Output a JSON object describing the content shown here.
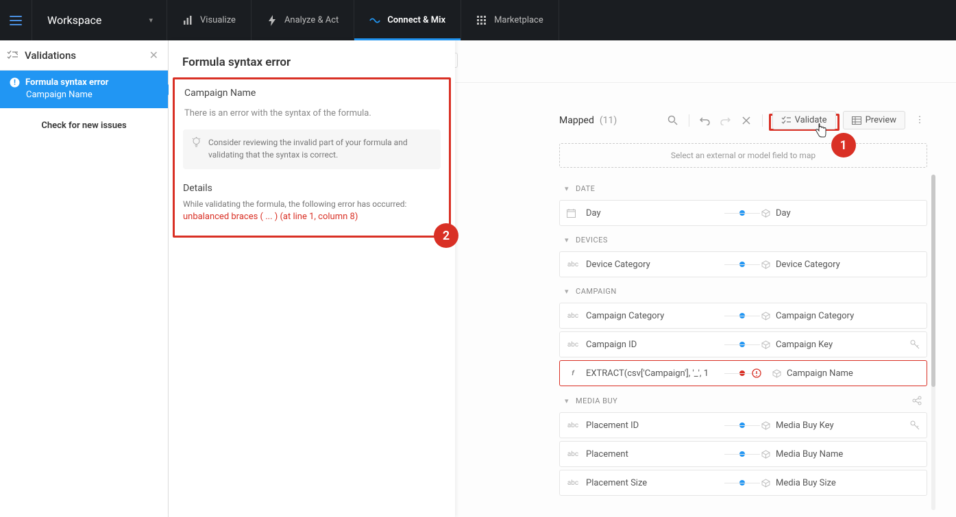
{
  "topbar": {
    "workspace": "Workspace",
    "tabs": {
      "visualize": "Visualize",
      "analyze": "Analyze & Act",
      "connect": "Connect & Mix",
      "marketplace": "Marketplace"
    }
  },
  "sidebar": {
    "title": "Validations",
    "issue": {
      "title": "Formula syntax error",
      "sub": "Campaign Name"
    },
    "check_new": "Check for new issues"
  },
  "details": {
    "title": "Formula syntax error",
    "field": "Campaign Name",
    "msg": "There is an error with the syntax of the formula.",
    "tip": "Consider reviewing the invalid part of your formula and validating that the syntax is correct.",
    "section": "Details",
    "err_intro": "While validating the formula, the following error has occurred:",
    "err": "unbalanced braces ( ... ) (at line 1, column 8)",
    "badge1": "1",
    "badge2": "2"
  },
  "toolbar": {
    "mapped_label": "Mapped",
    "mapped_count": "(11)",
    "validate": "Validate",
    "preview": "Preview"
  },
  "placeholder": "Select an external or model field to map",
  "groups": {
    "date": "DATE",
    "devices": "DEVICES",
    "campaign": "CAMPAIGN",
    "mediabuy": "MEDIA BUY"
  },
  "rows": {
    "day": {
      "left": "Day",
      "right": "Day"
    },
    "device": {
      "left": "Device Category",
      "right": "Device Category"
    },
    "camp_cat": {
      "left": "Campaign Category",
      "right": "Campaign Category"
    },
    "camp_id": {
      "left": "Campaign ID",
      "right": "Campaign Key"
    },
    "camp_name": {
      "left": "EXTRACT(csv['Campaign'], '_', 1",
      "right": "Campaign Name"
    },
    "place_id": {
      "left": "Placement ID",
      "right": "Media Buy Key"
    },
    "place": {
      "left": "Placement",
      "right": "Media Buy Name"
    },
    "place_size": {
      "left": "Placement Size",
      "right": "Media Buy Size"
    }
  }
}
